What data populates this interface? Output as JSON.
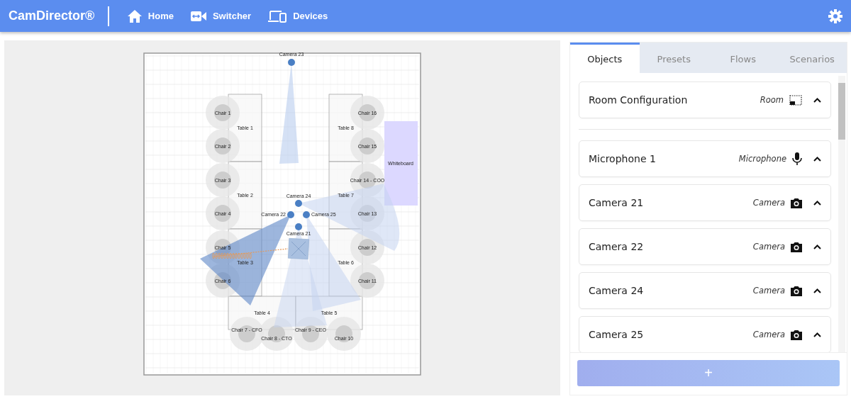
{
  "header": {
    "brand": "CamDirector®",
    "nav": [
      {
        "label": "Home",
        "kind": "home"
      },
      {
        "label": "Switcher",
        "kind": "switcher"
      },
      {
        "label": "Devices",
        "kind": "devices"
      }
    ]
  },
  "floor_plan": {
    "tables": [
      {
        "label": "Table 1"
      },
      {
        "label": "Table 2"
      },
      {
        "label": "Table 3"
      },
      {
        "label": "Table 8"
      },
      {
        "label": "Table 7"
      },
      {
        "label": "Table 6"
      },
      {
        "label": "Table 4"
      },
      {
        "label": "Table 5"
      }
    ],
    "chairs": [
      {
        "label": "Chair 1"
      },
      {
        "label": "Chair 2"
      },
      {
        "label": "Chair 3"
      },
      {
        "label": "Chair 4"
      },
      {
        "label": "Chair 5"
      },
      {
        "label": "Chair 6"
      },
      {
        "label": "Chair 16"
      },
      {
        "label": "Chair 15"
      },
      {
        "label": "Chair 14 - COO"
      },
      {
        "label": "Chair 13"
      },
      {
        "label": "Chair 12"
      },
      {
        "label": "Chair 11"
      },
      {
        "label": "Chair 7 - CFO"
      },
      {
        "label": "Chair 8 - CTO"
      },
      {
        "label": "Chair 9 - CEO"
      },
      {
        "label": "Chair 10"
      }
    ],
    "whiteboard": {
      "label": "Whiteboard"
    },
    "cameras": [
      {
        "label": "Camera 23"
      },
      {
        "label": "Camera 24"
      },
      {
        "label": "Camera 22"
      },
      {
        "label": "Camera 25"
      },
      {
        "label": "Camera 21"
      }
    ]
  },
  "panel": {
    "tabs": [
      {
        "label": "Objects",
        "selected": true
      },
      {
        "label": "Presets",
        "selected": false
      },
      {
        "label": "Flows",
        "selected": false
      },
      {
        "label": "Scenarios",
        "selected": false
      }
    ],
    "objects": [
      {
        "name": "Room Configuration",
        "type": "Room",
        "kind": "room"
      },
      {
        "name": "Microphone 1",
        "type": "Microphone",
        "kind": "microphone"
      },
      {
        "name": "Camera 21",
        "type": "Camera",
        "kind": "camera"
      },
      {
        "name": "Camera 22",
        "type": "Camera",
        "kind": "camera"
      },
      {
        "name": "Camera 24",
        "type": "Camera",
        "kind": "camera"
      },
      {
        "name": "Camera 25",
        "type": "Camera",
        "kind": "camera"
      }
    ],
    "add_button": "+"
  }
}
